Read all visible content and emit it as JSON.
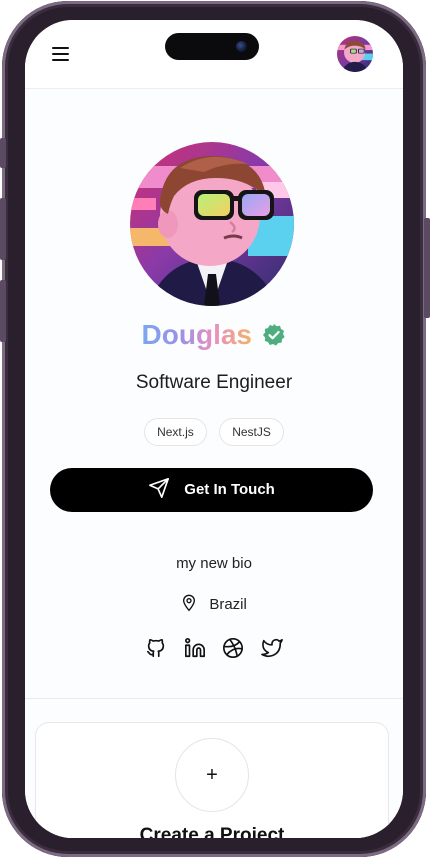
{
  "header": {
    "menu_icon": "hamburger-menu-icon",
    "avatar_icon": "user-avatar"
  },
  "profile": {
    "name": "Douglas",
    "verified_icon": "verified-badge-icon",
    "title": "Software Engineer",
    "tags": [
      "Next.js",
      "NestJS"
    ],
    "cta_label": "Get In Touch",
    "cta_icon": "send-icon",
    "bio": "my new bio",
    "location": "Brazil",
    "location_icon": "map-pin-icon",
    "socials": [
      "github-icon",
      "linkedin-icon",
      "dribbble-icon",
      "twitter-icon"
    ]
  },
  "projects": {
    "add_icon_label": "+",
    "create_label": "Create a Project"
  },
  "colors": {
    "name_gradient": [
      "#7aa7f0",
      "#9d8fe8",
      "#e98fbf",
      "#f2b26a"
    ],
    "cta_bg": "#000000",
    "verified_badge": "#4fae7f"
  }
}
